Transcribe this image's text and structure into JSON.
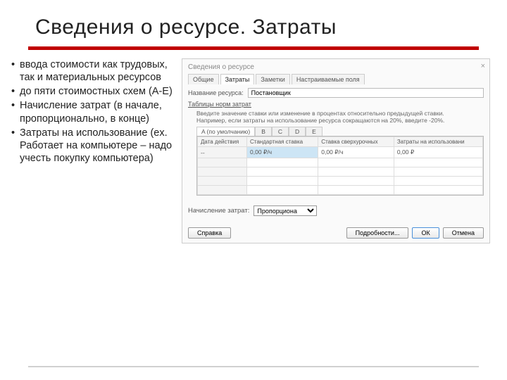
{
  "title": "Сведения о ресурсе. Затраты",
  "bullets": [
    "ввода стоимости как трудовых, так и материальных ресурсов",
    "до пяти стоимостных схем (A-E)",
    "Начисление затрат (в начале, пропорционально,  в конце)",
    "Затраты на использование (ex. Работает на компьютере – надо учесть покупку компьютера)"
  ],
  "dialog": {
    "title": "Сведения о ресурсе",
    "close": "×",
    "tabs": [
      "Общие",
      "Затраты",
      "Заметки",
      "Настраиваемые поля"
    ],
    "active_tab": 1,
    "resource_label": "Название ресурса:",
    "resource_value": "Постановщик",
    "section": "Таблицы норм затрат",
    "hint1": "Введите значение ставки или изменение в процентах относительно предыдущей ставки.",
    "hint2": "Например, если затраты на использование ресурса сокращаются на 20%, введите -20%.",
    "subtabs": [
      "A (по умолчанию)",
      "B",
      "C",
      "D",
      "E"
    ],
    "grid": {
      "headers": [
        "Дата действия",
        "Стандартная ставка",
        "Ставка сверхурочных",
        "Затраты на использовани"
      ],
      "row0": {
        "c0": "--",
        "c1": "0,00 ₽/ч",
        "c2": "0,00 ₽/ч",
        "c3": "0,00 ₽"
      }
    },
    "accrual_label": "Начисление затрат:",
    "accrual_value": "Пропорциона",
    "buttons": {
      "help": "Справка",
      "details": "Подробности...",
      "ok": "ОК",
      "cancel": "Отмена"
    }
  }
}
